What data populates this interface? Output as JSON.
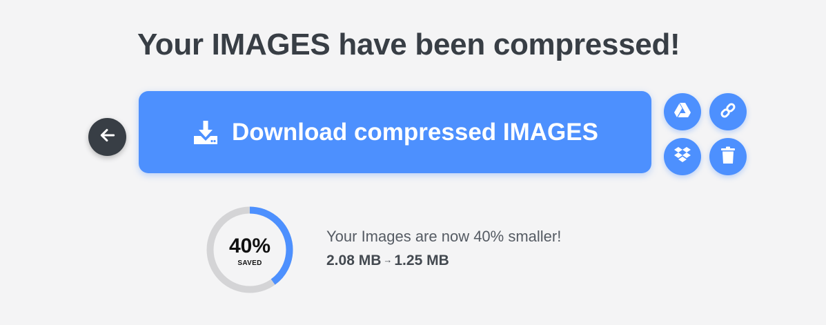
{
  "title": "Your IMAGES have been compressed!",
  "download": {
    "label": "Download compressed IMAGES",
    "icon": "download-icon"
  },
  "actions": {
    "back_icon": "arrow-left-icon",
    "drive_icon": "google-drive-icon",
    "link_icon": "link-icon",
    "dropbox_icon": "dropbox-icon",
    "trash_icon": "trash-icon"
  },
  "result": {
    "percent_value": 40,
    "percent_label": "40%",
    "saved_label": "SAVED",
    "message": "Your Images are now 40% smaller!",
    "original_size": "2.08 MB",
    "arrow": "→",
    "compressed_size": "1.25 MB"
  },
  "colors": {
    "accent": "#4d90fe",
    "dark": "#383e45",
    "ring_track": "#d4d4d6",
    "background": "#f4f4f5"
  }
}
